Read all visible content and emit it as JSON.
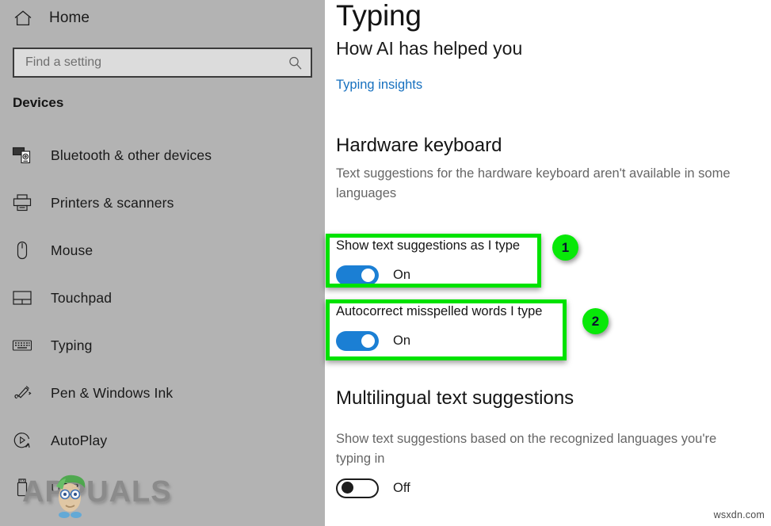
{
  "sidebar": {
    "home": {
      "label": "Home",
      "icon": "home-icon"
    },
    "search": {
      "value": "",
      "placeholder": "Find a setting",
      "icon": "search-icon"
    },
    "group_title": "Devices",
    "items": [
      {
        "label": "Bluetooth & other devices",
        "icon": "bluetooth-devices-icon",
        "selected": false
      },
      {
        "label": "Printers & scanners",
        "icon": "printer-icon",
        "selected": false
      },
      {
        "label": "Mouse",
        "icon": "mouse-icon",
        "selected": false
      },
      {
        "label": "Touchpad",
        "icon": "touchpad-icon",
        "selected": false
      },
      {
        "label": "Typing",
        "icon": "keyboard-icon",
        "selected": true
      },
      {
        "label": "Pen & Windows Ink",
        "icon": "pen-icon",
        "selected": false
      },
      {
        "label": "AutoPlay",
        "icon": "autoplay-icon",
        "selected": false
      },
      {
        "label": "USB",
        "icon": "usb-icon",
        "selected": false
      }
    ]
  },
  "main": {
    "page_title": "Typing",
    "insights_heading": "How AI has helped you",
    "insights_link": "Typing insights",
    "hardware": {
      "heading": "Hardware keyboard",
      "description": "Text suggestions for the hardware keyboard aren't available in some languages",
      "settings": [
        {
          "label": "Show text suggestions as I type",
          "state": "On",
          "on": true
        },
        {
          "label": "Autocorrect misspelled words I type",
          "state": "On",
          "on": true
        }
      ]
    },
    "multilingual": {
      "heading": "Multilingual text suggestions",
      "description": "Show text suggestions based on the recognized languages you're typing in",
      "setting": {
        "label": "",
        "state": "Off",
        "on": false
      }
    }
  },
  "annotations": [
    {
      "number": "1",
      "target": "show-text-suggestions-setting"
    },
    {
      "number": "2",
      "target": "autocorrect-misspelled-words-setting"
    }
  ],
  "watermarks": {
    "brand": "APPUALS",
    "site": "wsxdn.com"
  },
  "colors": {
    "sidebar_bg": "#b3b3b3",
    "accent_blue": "#1b7fd4",
    "link_blue": "#1670bf",
    "highlight_green": "#00e200",
    "badge_green": "#08e808"
  }
}
